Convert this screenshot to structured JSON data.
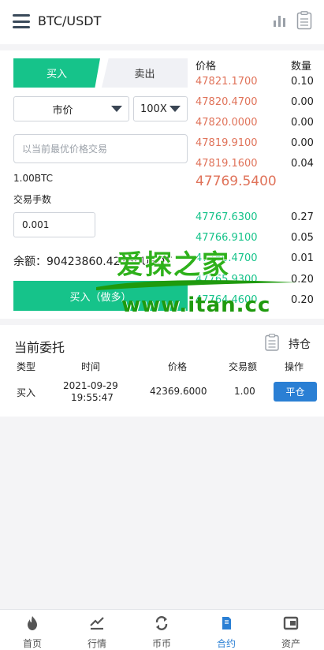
{
  "header": {
    "title": "BTC/USDT"
  },
  "trade": {
    "tab_buy": "买入",
    "tab_sell": "卖出",
    "order_type": "市价",
    "leverage": "100X",
    "price_placeholder": "以当前最优价格交易",
    "amount": "1.00BTC",
    "fee_label": "交易手数",
    "fee_value": "0.001",
    "balance": "余额：90423860.42150USDT",
    "buy_button": "买入（做多）"
  },
  "orderbook": {
    "price_header": "价格",
    "qty_header": "数量",
    "asks": [
      {
        "price": "47821.1700",
        "qty": "0.10"
      },
      {
        "price": "47820.4700",
        "qty": "0.00"
      },
      {
        "price": "47820.0000",
        "qty": "0.00"
      },
      {
        "price": "47819.9100",
        "qty": "0.00"
      },
      {
        "price": "47819.1600",
        "qty": "0.04"
      }
    ],
    "last_price": "47769.5400",
    "bids": [
      {
        "price": "47767.6300",
        "qty": "0.27"
      },
      {
        "price": "47766.9100",
        "qty": "0.05"
      },
      {
        "price": "47766.4700",
        "qty": "0.01"
      },
      {
        "price": "47765.9300",
        "qty": "0.20"
      },
      {
        "price": "47764.4600",
        "qty": "0.20"
      }
    ]
  },
  "watermark": {
    "logo": "爱探之家",
    "url": "www.itan.cc"
  },
  "orders": {
    "title": "当前委托",
    "hold_label": "持仓",
    "headers": [
      "类型",
      "时间",
      "价格",
      "交易额",
      "操作"
    ],
    "rows": [
      {
        "type": "买入",
        "date": "2021-09-29",
        "time": "19:55:47",
        "price": "42369.6000",
        "volume": "1.00",
        "action": "平仓"
      }
    ]
  },
  "tabbar": {
    "items": [
      {
        "label": "首页",
        "icon": "flame-icon"
      },
      {
        "label": "行情",
        "icon": "chart-line-icon"
      },
      {
        "label": "币币",
        "icon": "exchange-icon"
      },
      {
        "label": "合约",
        "icon": "document-icon",
        "active": true
      },
      {
        "label": "资产",
        "icon": "wallet-icon"
      }
    ],
    "active_color": "#2a7fd4"
  },
  "colors": {
    "green": "#16c38a",
    "red": "#e0735a",
    "blue": "#2a7fd4"
  }
}
